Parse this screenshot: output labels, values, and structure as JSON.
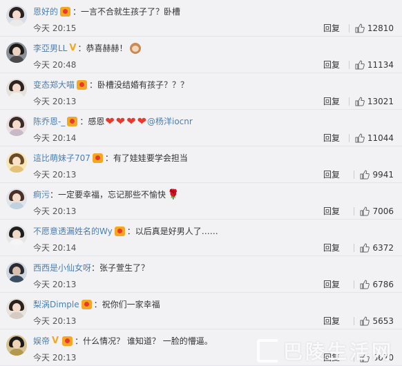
{
  "comments": [
    {
      "user": "恩好的",
      "badge": "vip",
      "text": "一言不合就生孩子了？卧槽",
      "time": "今天 20:15",
      "reply": "回复",
      "likes": "12810"
    },
    {
      "user": "李亞男LL",
      "badge": "v",
      "text": "恭喜赫赫！",
      "time": "今天 20:48",
      "reply": "回复",
      "likes": "11134"
    },
    {
      "user": "变态郑大喵",
      "badge": "vip",
      "text": "卧槽没结婚有孩子？？？",
      "time": "今天 20:13",
      "reply": "回复",
      "likes": "13021"
    },
    {
      "user": "陈乔恩-_",
      "badge": "vip",
      "text": "感恩",
      "mention": "@杨洋iocnr",
      "time": "今天 20:14",
      "reply": "回复",
      "likes": "11044"
    },
    {
      "user": "這比萌妹子707",
      "badge": "vip",
      "text": "有了娃娃要学会担当",
      "time": "今天 20:13",
      "reply": "回复",
      "likes": "9941"
    },
    {
      "user": "痾污",
      "badge": "",
      "text": "一定要幸福，忘记那些不愉快",
      "time": "今天 20:13",
      "reply": "回复",
      "likes": "7006"
    },
    {
      "user": "不愿意透漏姓名的Wy",
      "badge": "vip",
      "text": "以后真是好男人了……",
      "time": "今天 20:14",
      "reply": "回复",
      "likes": "6372"
    },
    {
      "user": "西西是小仙女呀",
      "badge": "",
      "text": "张子萱生了？",
      "time": "今天 20:13",
      "reply": "回复",
      "likes": "6786"
    },
    {
      "user": "梨涡Dimple",
      "badge": "vip",
      "text": "祝你们一家幸福",
      "time": "今天 20:13",
      "reply": "回复",
      "likes": "5653"
    },
    {
      "user": "娱帝",
      "badge": "v",
      "text": "什么情况？ 谁知道？ 一脸的懵逼。",
      "time": "今天 20:13",
      "reply": "回复",
      "likes": "6670"
    }
  ],
  "sep": "：",
  "watermark": "巴陵生活网",
  "colors": {
    "username": "#4a7fb5",
    "background": "#f2f2f5",
    "vip": "#f5a623"
  }
}
